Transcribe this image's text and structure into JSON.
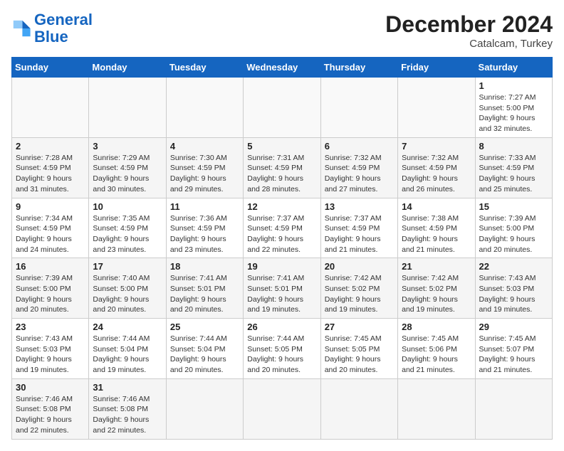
{
  "header": {
    "logo_line1": "General",
    "logo_line2": "Blue",
    "month": "December 2024",
    "location": "Catalcam, Turkey"
  },
  "weekdays": [
    "Sunday",
    "Monday",
    "Tuesday",
    "Wednesday",
    "Thursday",
    "Friday",
    "Saturday"
  ],
  "days": [
    {
      "num": "",
      "info": ""
    },
    {
      "num": "",
      "info": ""
    },
    {
      "num": "",
      "info": ""
    },
    {
      "num": "",
      "info": ""
    },
    {
      "num": "",
      "info": ""
    },
    {
      "num": "",
      "info": ""
    },
    {
      "num": "1",
      "info": "Sunrise: 7:27 AM\nSunset: 5:00 PM\nDaylight: 9 hours\nand 32 minutes."
    },
    {
      "num": "2",
      "info": "Sunrise: 7:28 AM\nSunset: 4:59 PM\nDaylight: 9 hours\nand 31 minutes."
    },
    {
      "num": "3",
      "info": "Sunrise: 7:29 AM\nSunset: 4:59 PM\nDaylight: 9 hours\nand 30 minutes."
    },
    {
      "num": "4",
      "info": "Sunrise: 7:30 AM\nSunset: 4:59 PM\nDaylight: 9 hours\nand 29 minutes."
    },
    {
      "num": "5",
      "info": "Sunrise: 7:31 AM\nSunset: 4:59 PM\nDaylight: 9 hours\nand 28 minutes."
    },
    {
      "num": "6",
      "info": "Sunrise: 7:32 AM\nSunset: 4:59 PM\nDaylight: 9 hours\nand 27 minutes."
    },
    {
      "num": "7",
      "info": "Sunrise: 7:32 AM\nSunset: 4:59 PM\nDaylight: 9 hours\nand 26 minutes."
    },
    {
      "num": "8",
      "info": "Sunrise: 7:33 AM\nSunset: 4:59 PM\nDaylight: 9 hours\nand 25 minutes."
    },
    {
      "num": "9",
      "info": "Sunrise: 7:34 AM\nSunset: 4:59 PM\nDaylight: 9 hours\nand 24 minutes."
    },
    {
      "num": "10",
      "info": "Sunrise: 7:35 AM\nSunset: 4:59 PM\nDaylight: 9 hours\nand 23 minutes."
    },
    {
      "num": "11",
      "info": "Sunrise: 7:36 AM\nSunset: 4:59 PM\nDaylight: 9 hours\nand 23 minutes."
    },
    {
      "num": "12",
      "info": "Sunrise: 7:37 AM\nSunset: 4:59 PM\nDaylight: 9 hours\nand 22 minutes."
    },
    {
      "num": "13",
      "info": "Sunrise: 7:37 AM\nSunset: 4:59 PM\nDaylight: 9 hours\nand 21 minutes."
    },
    {
      "num": "14",
      "info": "Sunrise: 7:38 AM\nSunset: 4:59 PM\nDaylight: 9 hours\nand 21 minutes."
    },
    {
      "num": "15",
      "info": "Sunrise: 7:39 AM\nSunset: 5:00 PM\nDaylight: 9 hours\nand 20 minutes."
    },
    {
      "num": "16",
      "info": "Sunrise: 7:39 AM\nSunset: 5:00 PM\nDaylight: 9 hours\nand 20 minutes."
    },
    {
      "num": "17",
      "info": "Sunrise: 7:40 AM\nSunset: 5:00 PM\nDaylight: 9 hours\nand 20 minutes."
    },
    {
      "num": "18",
      "info": "Sunrise: 7:41 AM\nSunset: 5:01 PM\nDaylight: 9 hours\nand 20 minutes."
    },
    {
      "num": "19",
      "info": "Sunrise: 7:41 AM\nSunset: 5:01 PM\nDaylight: 9 hours\nand 19 minutes."
    },
    {
      "num": "20",
      "info": "Sunrise: 7:42 AM\nSunset: 5:02 PM\nDaylight: 9 hours\nand 19 minutes."
    },
    {
      "num": "21",
      "info": "Sunrise: 7:42 AM\nSunset: 5:02 PM\nDaylight: 9 hours\nand 19 minutes."
    },
    {
      "num": "22",
      "info": "Sunrise: 7:43 AM\nSunset: 5:03 PM\nDaylight: 9 hours\nand 19 minutes."
    },
    {
      "num": "23",
      "info": "Sunrise: 7:43 AM\nSunset: 5:03 PM\nDaylight: 9 hours\nand 19 minutes."
    },
    {
      "num": "24",
      "info": "Sunrise: 7:44 AM\nSunset: 5:04 PM\nDaylight: 9 hours\nand 19 minutes."
    },
    {
      "num": "25",
      "info": "Sunrise: 7:44 AM\nSunset: 5:04 PM\nDaylight: 9 hours\nand 20 minutes."
    },
    {
      "num": "26",
      "info": "Sunrise: 7:44 AM\nSunset: 5:05 PM\nDaylight: 9 hours\nand 20 minutes."
    },
    {
      "num": "27",
      "info": "Sunrise: 7:45 AM\nSunset: 5:05 PM\nDaylight: 9 hours\nand 20 minutes."
    },
    {
      "num": "28",
      "info": "Sunrise: 7:45 AM\nSunset: 5:06 PM\nDaylight: 9 hours\nand 21 minutes."
    },
    {
      "num": "29",
      "info": "Sunrise: 7:45 AM\nSunset: 5:07 PM\nDaylight: 9 hours\nand 21 minutes."
    },
    {
      "num": "30",
      "info": "Sunrise: 7:46 AM\nSunset: 5:08 PM\nDaylight: 9 hours\nand 22 minutes."
    },
    {
      "num": "31",
      "info": "Sunrise: 7:46 AM\nSunset: 5:08 PM\nDaylight: 9 hours\nand 22 minutes."
    },
    {
      "num": "",
      "info": ""
    },
    {
      "num": "",
      "info": ""
    },
    {
      "num": "",
      "info": ""
    },
    {
      "num": "",
      "info": ""
    },
    {
      "num": "",
      "info": ""
    }
  ]
}
